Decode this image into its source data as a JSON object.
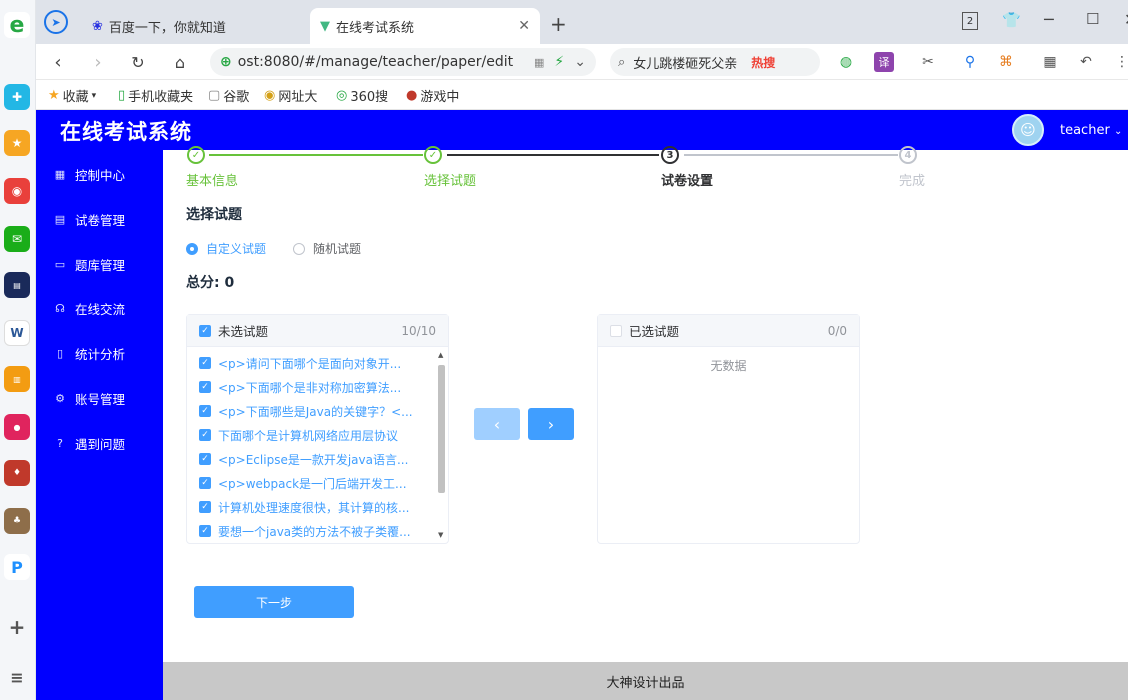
{
  "browser": {
    "tabs": [
      {
        "label": "百度一下，你就知道",
        "active": false
      },
      {
        "label": "在线考试系统",
        "active": true
      }
    ],
    "window_tab_count": "2",
    "url": "ost:8080/#/manage/teacher/paper/edit",
    "search_text": "女儿跳楼砸死父亲",
    "search_badge": "热搜",
    "translate_label": "译",
    "bookmarks": [
      "收藏",
      "手机收藏夹",
      "谷歌",
      "网址大",
      "360搜",
      "游戏中"
    ]
  },
  "app": {
    "title": "在线考试系统",
    "user": "teacher",
    "accent": "#0000ff"
  },
  "sidebar": {
    "items": [
      {
        "label": "控制中心",
        "icon": "grid-icon"
      },
      {
        "label": "试卷管理",
        "icon": "document-icon"
      },
      {
        "label": "题库管理",
        "icon": "folder-icon"
      },
      {
        "label": "在线交流",
        "icon": "headset-icon"
      },
      {
        "label": "统计分析",
        "icon": "mobile-icon"
      },
      {
        "label": "账号管理",
        "icon": "gear-icon"
      },
      {
        "label": "遇到问题",
        "icon": "question-icon"
      }
    ]
  },
  "steps": [
    {
      "label": "基本信息",
      "status": "done",
      "mark": "✓"
    },
    {
      "label": "选择试题",
      "status": "done",
      "mark": "✓"
    },
    {
      "label": "试卷设置",
      "status": "active",
      "mark": "3"
    },
    {
      "label": "完成",
      "status": "wait",
      "mark": "4"
    }
  ],
  "section": {
    "title": "选择试题",
    "radio_custom": "自定义试题",
    "radio_random": "随机试题",
    "total_label": "总分: 0"
  },
  "transfer": {
    "left_title": "未选试题",
    "left_count": "10/10",
    "right_title": "已选试题",
    "right_count": "0/0",
    "empty_text": "无数据",
    "left_items": [
      "<p>请问下面哪个是面向对象开...",
      "<p>下面哪个是非对称加密算法...",
      "<p>下面哪些是Java的关键字？<...",
      "下面哪个是计算机网络应用层协议",
      "<p>Eclipse是一款开发java语言...",
      "<p>webpack是一门后端开发工...",
      "计算机处理速度很快，其计算的核...",
      "要想一个java类的方法不被子类覆..."
    ],
    "btn_left": "‹",
    "btn_right": "›"
  },
  "next_button": "下一步",
  "footer": "大神设计出品"
}
